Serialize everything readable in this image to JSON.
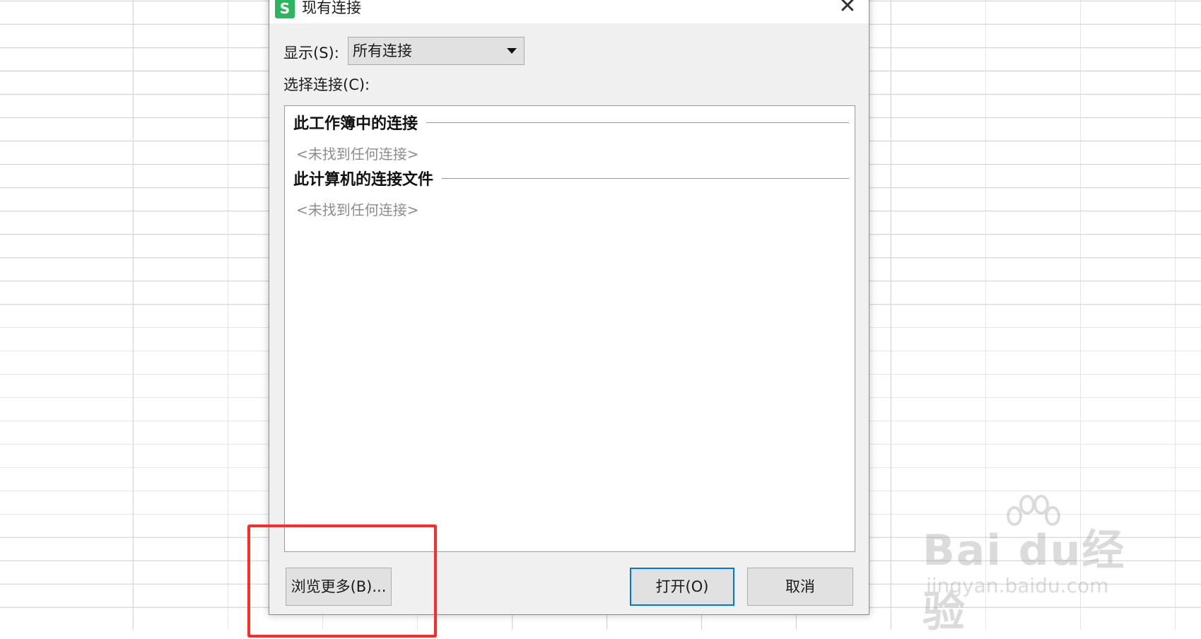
{
  "dialog": {
    "title": "现有连接",
    "app_icon_letter": "S",
    "close_glyph": "✕",
    "show_label": "显示(S):",
    "show_value": "所有连接",
    "choose_label": "选择连接(C):",
    "groups": [
      {
        "header": "此工作簿中的连接",
        "empty_text": "<未找到任何连接>"
      },
      {
        "header": "此计算机的连接文件",
        "empty_text": "<未找到任何连接>"
      }
    ],
    "buttons": {
      "browse": "浏览更多(B)...",
      "open": "打开(O)",
      "cancel": "取消"
    }
  },
  "watermark": {
    "logo": "Bai du经验",
    "url": "jingyan.baidu.com"
  },
  "colors": {
    "accent": "#0078d7",
    "highlight": "#ff2a2a",
    "app_icon": "#2fb45e"
  }
}
